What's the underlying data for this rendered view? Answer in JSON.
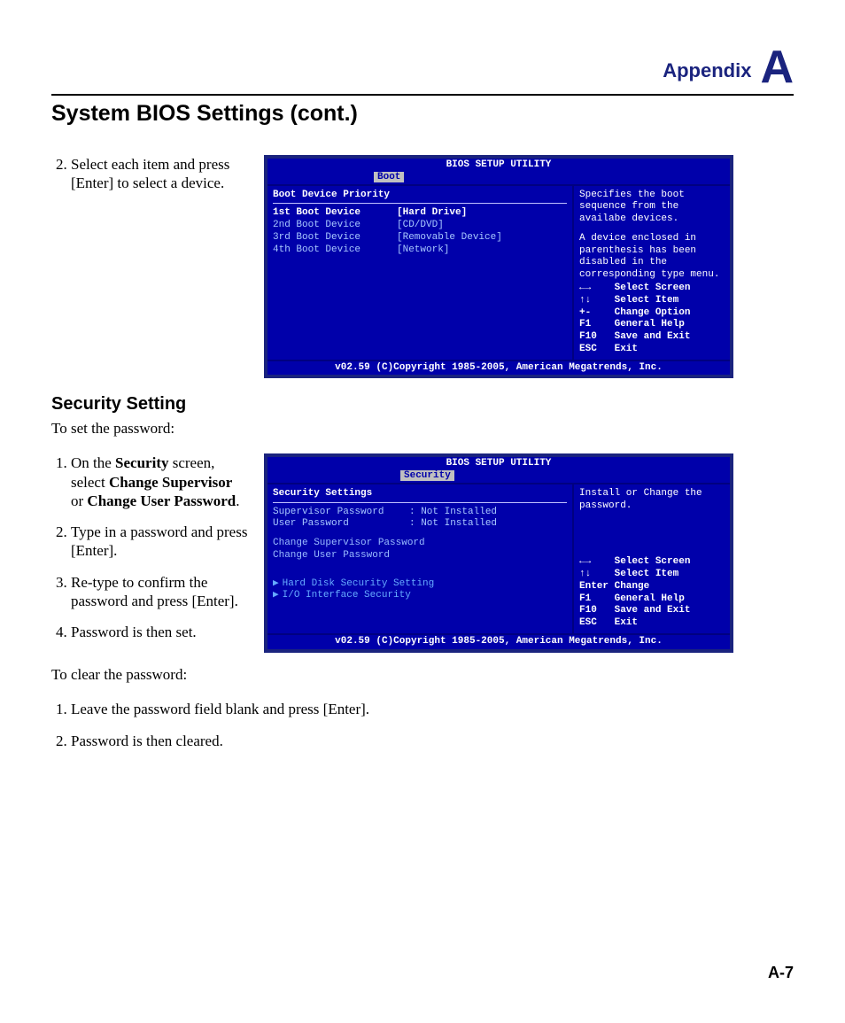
{
  "header": {
    "appendix_word": "Appendix",
    "appendix_letter": "A",
    "page_number": "A-7"
  },
  "page_title": "System BIOS Settings (cont.)",
  "step_a": {
    "num": "2.",
    "text": "Select each item and press [Enter] to select a device."
  },
  "bios1": {
    "title": "BIOS SETUP UTILITY",
    "tab": "Boot",
    "heading": "Boot Device Priority",
    "rows": [
      {
        "k": "1st Boot Device",
        "v": "[Hard Drive]"
      },
      {
        "k": "2nd Boot Device",
        "v": "[CD/DVD]"
      },
      {
        "k": "3rd Boot Device",
        "v": "[Removable Device]"
      },
      {
        "k": "4th Boot Device",
        "v": "[Network]"
      }
    ],
    "help_top": "Specifies the boot sequence from the availabe devices.",
    "help_mid": "A device enclosed in parenthesis has been disabled in the corresponding type menu.",
    "keys": [
      {
        "k": "←→",
        "d": "Select Screen"
      },
      {
        "k": "↑↓",
        "d": "Select Item"
      },
      {
        "k": "+-",
        "d": "Change Option"
      },
      {
        "k": "F1",
        "d": "General Help"
      },
      {
        "k": "F10",
        "d": "Save and Exit"
      },
      {
        "k": "ESC",
        "d": "Exit"
      }
    ],
    "footer": "v02.59 (C)Copyright 1985-2005, American Megatrends, Inc."
  },
  "section2_title": "Security Setting",
  "section2_intro": "To set the password:",
  "steps_b": [
    {
      "pre": "On the ",
      "b1": "Security",
      "mid1": " screen, select ",
      "b2": "Change Supervisor",
      "mid2": " or ",
      "b3": "Change User Password",
      "post": "."
    },
    {
      "text": "Type in a password and press [Enter]."
    },
    {
      "text": "Re-type to confirm the password and press [Enter]."
    },
    {
      "text": "Password is then set."
    }
  ],
  "bios2": {
    "title": "BIOS SETUP UTILITY",
    "tab": "Security",
    "heading": "Security Settings",
    "rows_status": [
      {
        "k": "Supervisor Password",
        "v": ": Not Installed"
      },
      {
        "k": "User Password",
        "v": ": Not Installed"
      }
    ],
    "rows_change": [
      "Change Supervisor Password",
      "Change User Password"
    ],
    "rows_sub": [
      "Hard Disk Security Setting",
      "I/O Interface Security"
    ],
    "help_top": "Install or Change the password.",
    "keys": [
      {
        "k": "←→",
        "d": "Select Screen"
      },
      {
        "k": "↑↓",
        "d": "Select Item"
      },
      {
        "k": "Enter",
        "d": "Change"
      },
      {
        "k": "F1",
        "d": "General Help"
      },
      {
        "k": "F10",
        "d": "Save and Exit"
      },
      {
        "k": "ESC",
        "d": "Exit"
      }
    ],
    "footer": "v02.59 (C)Copyright 1985-2005, American Megatrends, Inc."
  },
  "section2_outro": "To clear the password:",
  "steps_c": [
    "Leave the password field blank and press [Enter].",
    "Password is then cleared."
  ]
}
